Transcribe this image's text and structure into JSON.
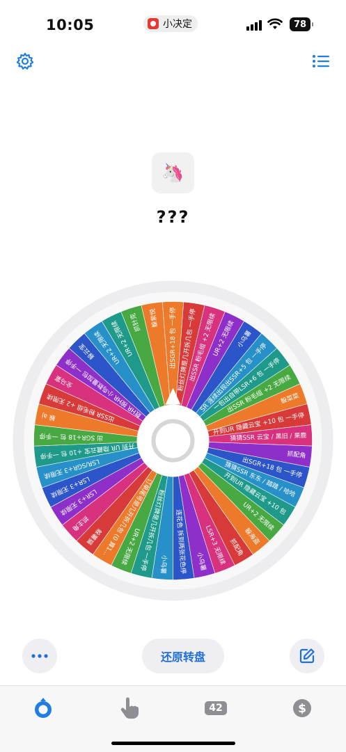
{
  "status": {
    "time": "10:05",
    "app_name": "小决定",
    "battery": "78"
  },
  "header": {
    "settings_icon": "gear-icon",
    "list_icon": "list-icon"
  },
  "result": {
    "emoji": "🦄",
    "text": "???"
  },
  "wheel": {
    "segments": [
      {
        "label": "出SGR+18 包 一手停",
        "color": "#ec7a2a"
      },
      {
        "label": "粉丝灯牌是几开拆几包 一手停",
        "color": "#d83a3a"
      },
      {
        "label": "出SSR 粉毛组 +2 无限续",
        "color": "#d8317d"
      },
      {
        "label": "UR+2 无限续",
        "color": "#8e2fc9"
      },
      {
        "label": "小乌薯",
        "color": "#2c55c9"
      },
      {
        "label": "SR 连续出现出SSR+5 包 一手停",
        "color": "#2790c9"
      },
      {
        "label": "一包出自带LSR+6 包 一手停",
        "color": "#1f9a8a"
      },
      {
        "label": "出SSR 粉毛组 +2 无限续",
        "color": "#48a943"
      },
      {
        "label": "躲菜菜",
        "color": "#ec7a2a"
      },
      {
        "label": "开到UR 隐藏云宝 +10 包 一手停",
        "color": "#d83a3a"
      },
      {
        "label": "猜猜SSR 云宝 / 黑旧 / 果鹿",
        "color": "#d8317d"
      },
      {
        "label": "抓配角",
        "color": "#8e2fc9"
      },
      {
        "label": "出SGR+18 包 一手停",
        "color": "#2c55c9"
      },
      {
        "label": "猜猜SSR 东东 / 踏踏 / 哈哈",
        "color": "#2790c9"
      },
      {
        "label": "开到UR 隐藏云宝 +10 包",
        "color": "#1f9a8a"
      },
      {
        "label": "UR+2 无限续",
        "color": "#48a943"
      },
      {
        "label": "躲海盗",
        "color": "#ec7a2a"
      },
      {
        "label": "抓配角",
        "color": "#d83a3a"
      },
      {
        "label": "LSR+3 无限续",
        "color": "#d8317d"
      },
      {
        "label": "小乌薯",
        "color": "#8e2fc9"
      },
      {
        "label": "连花色 拆到两张花色停",
        "color": "#2c55c9"
      },
      {
        "label": "小乌薯",
        "color": "#2790c9"
      },
      {
        "label": "粉丝灯牌是几开拆几包 一手停",
        "color": "#1f9a8a"
      },
      {
        "label": "UR+2 无限续",
        "color": "#48a943"
      },
      {
        "label": "订单尾号是几开拆几包 (0 算1...",
        "color": "#ec7a2a"
      },
      {
        "label": "躲薯猫",
        "color": "#d83a3a"
      },
      {
        "label": "抓主角",
        "color": "#d8317d"
      },
      {
        "label": "LSR+3 无限续",
        "color": "#8e2fc9"
      },
      {
        "label": "LSR+3 无限续",
        "color": "#2c55c9"
      },
      {
        "label": "LSR/SGR+3 无限续",
        "color": "#2790c9"
      },
      {
        "label": "开到 UR 隐藏云宝 +10 包 一手停",
        "color": "#1f9a8a"
      },
      {
        "label": "出 SGR+18 包 一手停",
        "color": "#48a943"
      },
      {
        "label": "躲 aj",
        "color": "#ec7a2a"
      },
      {
        "label": "出SSR 粉毛组 +2 无限续",
        "color": "#d83a3a"
      },
      {
        "label": "全马宴",
        "color": "#d8317d"
      },
      {
        "label": "数HR 按HR 小鸟数量加包 一手停",
        "color": "#8e2fc9"
      },
      {
        "label": "躲云宝",
        "color": "#2c55c9"
      },
      {
        "label": "UR+2 无限续",
        "color": "#2790c9"
      },
      {
        "label": "UR+2 无限续",
        "color": "#1f9a8a"
      },
      {
        "label": "抓针克",
        "color": "#48a943"
      },
      {
        "label": "躲紫悦",
        "color": "#ec7a2a"
      }
    ]
  },
  "actions": {
    "more_icon": "ellipsis-icon",
    "reset_label": "还原转盘",
    "edit_icon": "edit-icon"
  },
  "tabbar": {
    "tab1_icon": "wheel-icon",
    "tab2_icon": "hand-pointer-icon",
    "tab3_badge": "42",
    "tab4_icon": "dollar-icon"
  }
}
